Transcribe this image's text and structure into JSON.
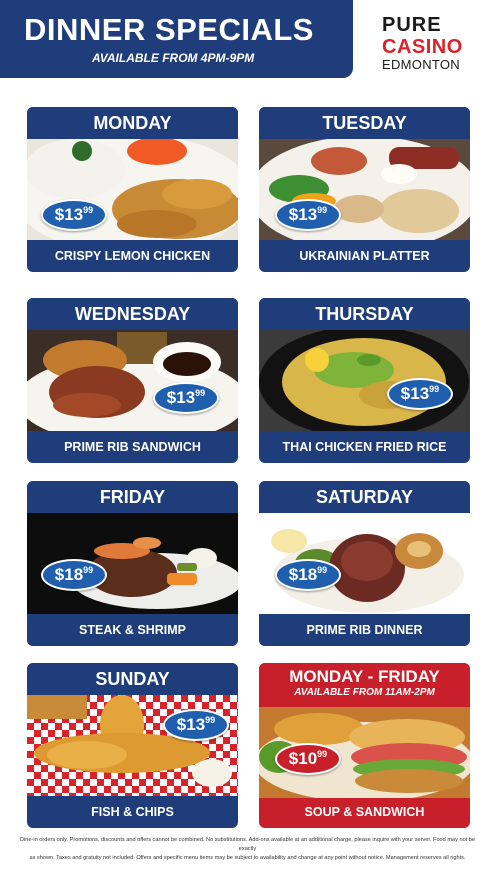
{
  "header": {
    "title": "DINNER SPECIALS",
    "subtitle": "AVAILABLE FROM 4PM-9PM"
  },
  "logo": {
    "line1": "PURE",
    "line2": "CASINO",
    "line3": "EDMONTON"
  },
  "specials": [
    {
      "day": "MONDAY",
      "dish": "CRISPY LEMON CHICKEN",
      "price_main": "$13",
      "price_cents": "99"
    },
    {
      "day": "TUESDAY",
      "dish": "UKRAINIAN PLATTER",
      "price_main": "$13",
      "price_cents": "99"
    },
    {
      "day": "WEDNESDAY",
      "dish": "PRIME RIB SANDWICH",
      "price_main": "$13",
      "price_cents": "99"
    },
    {
      "day": "THURSDAY",
      "dish": "THAI CHICKEN FRIED RICE",
      "price_main": "$13",
      "price_cents": "99"
    },
    {
      "day": "FRIDAY",
      "dish": "STEAK & SHRIMP",
      "price_main": "$18",
      "price_cents": "99"
    },
    {
      "day": "SATURDAY",
      "dish": "PRIME RIB DINNER",
      "price_main": "$18",
      "price_cents": "99"
    },
    {
      "day": "SUNDAY",
      "dish": "FISH & CHIPS",
      "price_main": "$13",
      "price_cents": "99"
    },
    {
      "day": "MONDAY - FRIDAY",
      "availability": "AVAILABLE FROM 11AM-2PM",
      "dish": "SOUP & SANDWICH",
      "price_main": "$10",
      "price_cents": "99"
    }
  ],
  "colors": {
    "navy": "#1f3d7a",
    "price_blue": "#1f5fae",
    "red": "#c8202a"
  },
  "footer": {
    "line1": "Dine-in orders only. Promotions, discounts and offers cannot be combined. No substitutions. Add-ons available at an additional charge, please inquire with your server. Food may not be exactly",
    "line2": "as shown. Taxes and gratuity not included. Offers and specific menu items may be subject to availability and change at any point without notice. Management reserves all rights."
  }
}
